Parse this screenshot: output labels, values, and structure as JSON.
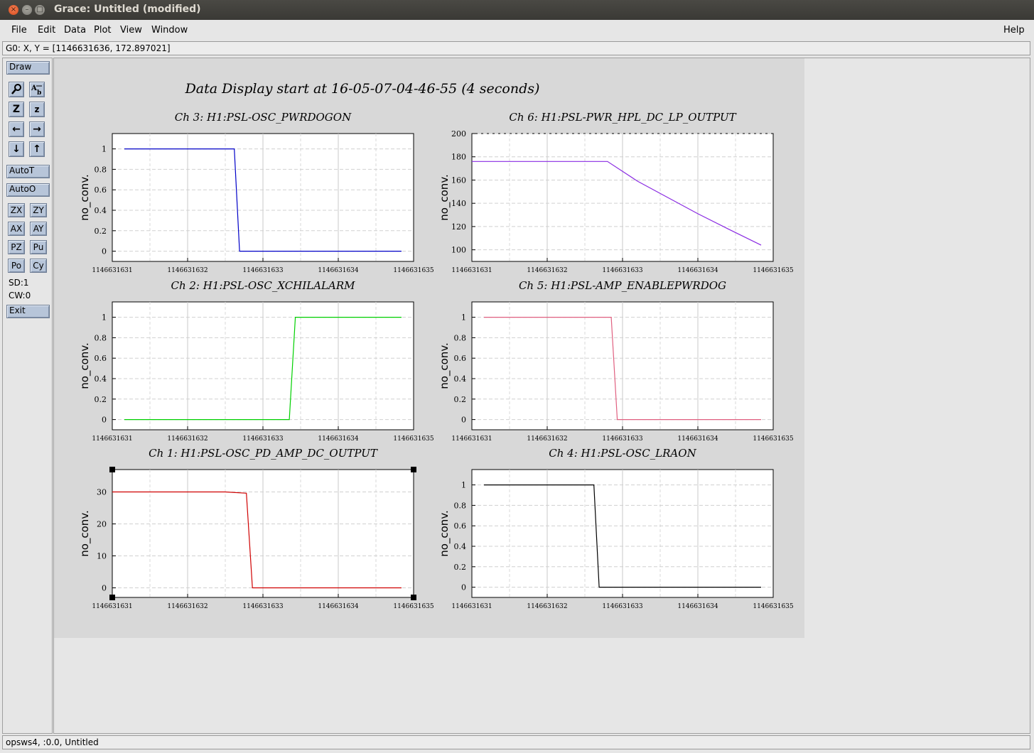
{
  "window": {
    "title": "Grace: Untitled (modified)",
    "close_glyph": "×",
    "min_glyph": "–",
    "max_glyph": "□"
  },
  "menu": {
    "file": "File",
    "edit": "Edit",
    "data": "Data",
    "plot": "Plot",
    "view": "View",
    "window": "Window",
    "help": "Help"
  },
  "locator": "G0: X, Y = [1146631636, 172.897021]",
  "tools": {
    "draw": "Draw",
    "autot": "AutoT",
    "autoo": "AutoO",
    "zx": "ZX",
    "zy": "ZY",
    "ax": "AX",
    "ay": "AY",
    "pz": "PZ",
    "pu": "Pu",
    "po": "Po",
    "cy": "Cy",
    "sd": "SD:1",
    "cw": "CW:0",
    "exit": "Exit",
    "zoom_in": "Z",
    "zoom_out": "z",
    "left": "←",
    "right": "→",
    "down": "↓",
    "up": "↑"
  },
  "statusbar": "opsws4, :0.0, Untitled",
  "colors": {
    "ch3": "#0000c8",
    "ch6": "#8a2be2",
    "ch2": "#00d000",
    "ch5": "#e06080",
    "ch1": "#d00000",
    "ch4": "#000000"
  },
  "chart_data": {
    "title": "Data Display start at 16-05-07-04-46-55 (4 seconds)",
    "type": "line",
    "x_ticks": [
      "1146631631",
      "1146631632",
      "1146631633",
      "1146631634",
      "1146631635"
    ],
    "xlim": [
      1146631631,
      1146631635
    ],
    "plots": [
      {
        "title": "Ch 3: H1:PSL-OSC_PWRDOGON",
        "ylabel": "no_conv.",
        "ylim": [
          -0.1,
          1.15
        ],
        "yticks": [
          "0",
          "0.2",
          "0.4",
          "0.6",
          "0.8",
          "1"
        ],
        "ytick_values": [
          0,
          0.2,
          0.4,
          0.6,
          0.8,
          1
        ],
        "color_key": "ch3",
        "x": [
          1146631631.16,
          1146631632.62,
          1146631632.69,
          1146631634.84
        ],
        "y": [
          1,
          1,
          0,
          0
        ]
      },
      {
        "title": "Ch 6: H1:PSL-PWR_HPL_DC_LP_OUTPUT",
        "ylabel": "no_conv.",
        "ylim": [
          90,
          200
        ],
        "yticks": [
          "100",
          "120",
          "140",
          "160",
          "180",
          "200"
        ],
        "ytick_values": [
          100,
          120,
          140,
          160,
          180,
          200
        ],
        "color_key": "ch6",
        "x": [
          1146631631,
          1146631632.8,
          1146631633.2,
          1146631633.6,
          1146631634.0,
          1146631634.4,
          1146631634.84
        ],
        "y": [
          176,
          176,
          159,
          145,
          131,
          118,
          104
        ]
      },
      {
        "title": "Ch 2: H1:PSL-OSC_XCHILALARM",
        "ylabel": "no_conv.",
        "ylim": [
          -0.1,
          1.15
        ],
        "yticks": [
          "0",
          "0.2",
          "0.4",
          "0.6",
          "0.8",
          "1"
        ],
        "ytick_values": [
          0,
          0.2,
          0.4,
          0.6,
          0.8,
          1
        ],
        "color_key": "ch2",
        "x": [
          1146631631.16,
          1146631633.35,
          1146631633.43,
          1146631634.84
        ],
        "y": [
          0,
          0,
          1,
          1
        ]
      },
      {
        "title": "Ch 5: H1:PSL-AMP_ENABLEPWRDOG",
        "ylabel": "no_conv.",
        "ylim": [
          -0.1,
          1.15
        ],
        "yticks": [
          "0",
          "0.2",
          "0.4",
          "0.6",
          "0.8",
          "1"
        ],
        "ytick_values": [
          0,
          0.2,
          0.4,
          0.6,
          0.8,
          1
        ],
        "color_key": "ch5",
        "x": [
          1146631631.16,
          1146631632.85,
          1146631632.93,
          1146631634.84
        ],
        "y": [
          1,
          1,
          0,
          0
        ]
      },
      {
        "title": "Ch 1: H1:PSL-OSC_PD_AMP_DC_OUTPUT",
        "ylabel": "no_conv.",
        "ylim": [
          -3,
          37
        ],
        "yticks": [
          "0",
          "10",
          "20",
          "30"
        ],
        "ytick_values": [
          0,
          10,
          20,
          30
        ],
        "color_key": "ch1",
        "x": [
          1146631631,
          1146631632.0,
          1146631632.5,
          1146631632.78,
          1146631632.86,
          1146631634.84
        ],
        "y": [
          30,
          30,
          30,
          29.6,
          0,
          0
        ]
      },
      {
        "title": "Ch 4: H1:PSL-OSC_LRAON",
        "ylabel": "no_conv.",
        "ylim": [
          -0.1,
          1.15
        ],
        "yticks": [
          "0",
          "0.2",
          "0.4",
          "0.6",
          "0.8",
          "1"
        ],
        "ytick_values": [
          0,
          0.2,
          0.4,
          0.6,
          0.8,
          1
        ],
        "color_key": "ch4",
        "x": [
          1146631631.16,
          1146631632.62,
          1146631632.69,
          1146631634.84
        ],
        "y": [
          1,
          1,
          0,
          0
        ]
      }
    ]
  }
}
